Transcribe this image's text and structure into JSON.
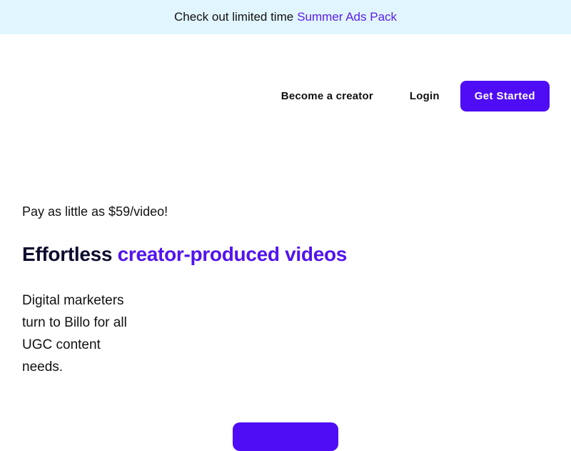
{
  "announcement": {
    "text": "Check out limited time",
    "link": "Summer Ads Pack"
  },
  "nav": {
    "become_creator": "Become a creator",
    "login": "Login",
    "get_started": "Get Started"
  },
  "hero": {
    "promo": "Pay as little as $59/video!",
    "headline_plain": "Effortless",
    "headline_accent": "creator-produced videos",
    "subtext": "Digital marketers turn to Billo for all UGC content needs."
  },
  "colors": {
    "brand": "#4f0df5",
    "accent_text": "#5213f0",
    "announcement_bg": "#e1f5fe"
  }
}
